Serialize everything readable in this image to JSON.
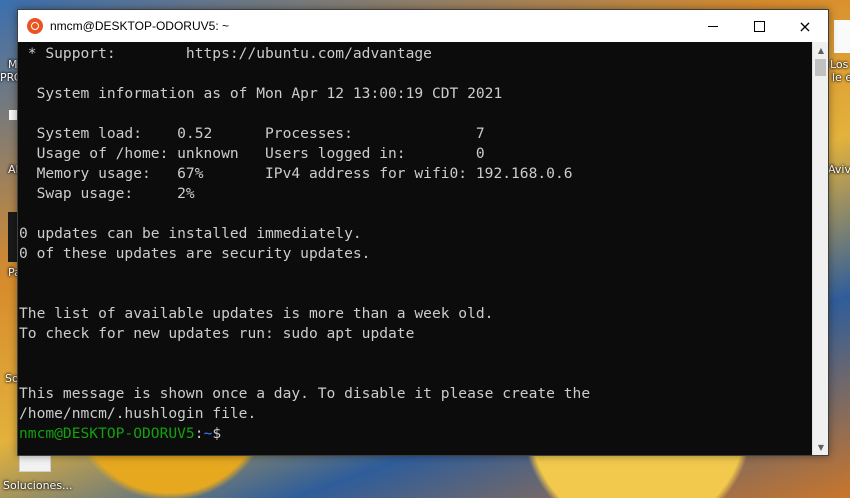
{
  "desktop": {
    "left_labels": [
      "M",
      "PRC",
      "Al",
      "Pa",
      "So"
    ],
    "right_labels": [
      "Los c",
      "le es",
      "Aviva"
    ],
    "bottom_icon_label": "Soluciones..."
  },
  "window": {
    "title": "nmcm@DESKTOP-ODORUV5: ~",
    "app_icon": "ubuntu-icon",
    "controls": {
      "minimize": "minimize-icon",
      "maximize": "maximize-icon",
      "close": "×"
    }
  },
  "terminal": {
    "lines": [
      " * Support:        https://ubuntu.com/advantage",
      "",
      "  System information as of Mon Apr 12 13:00:19 CDT 2021",
      "",
      "  System load:    0.52      Processes:              7",
      "  Usage of /home: unknown   Users logged in:        0",
      "  Memory usage:   67%       IPv4 address for wifi0: 192.168.0.6",
      "  Swap usage:     2%",
      "",
      "0 updates can be installed immediately.",
      "0 of these updates are security updates.",
      "",
      "",
      "The list of available updates is more than a week old.",
      "To check for new updates run: sudo apt update",
      "",
      "",
      "This message is shown once a day. To disable it please create the",
      "/home/nmcm/.hushlogin file."
    ],
    "prompt": {
      "user_host": "nmcm@DESKTOP-ODORUV5",
      "separator": ":",
      "path": "~",
      "symbol": "$"
    }
  },
  "colors": {
    "terminal_bg": "#0c0c0c",
    "terminal_fg": "#cccccc",
    "prompt_user": "#13a10e",
    "prompt_path": "#3b78ff",
    "ubuntu_orange": "#e95420"
  }
}
